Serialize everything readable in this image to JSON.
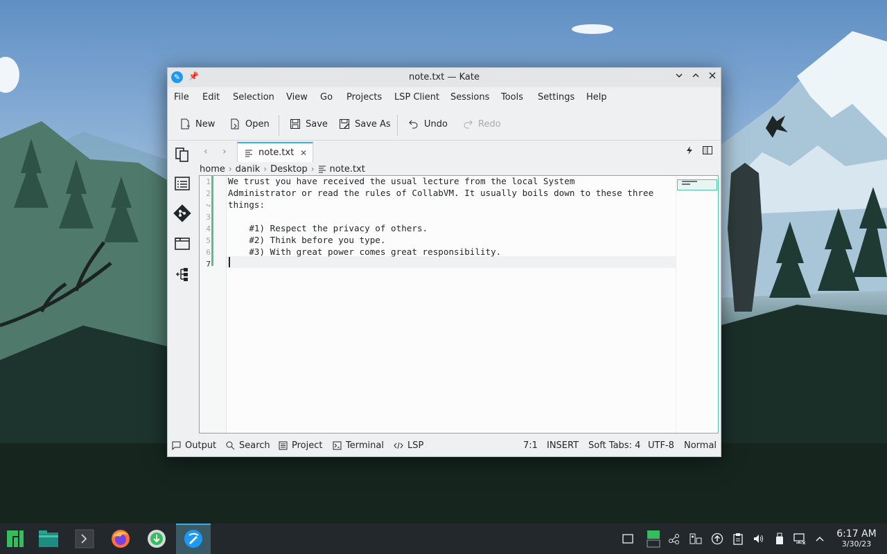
{
  "window": {
    "title": "note.txt — Kate"
  },
  "menu": [
    "File",
    "Edit",
    "Selection",
    "View",
    "Go",
    "Projects",
    "LSP Client",
    "Sessions",
    "Tools",
    "Settings",
    "Help"
  ],
  "toolbar": {
    "new": "New",
    "open": "Open",
    "save": "Save",
    "save_as": "Save As",
    "undo": "Undo",
    "redo": "Redo"
  },
  "tab": {
    "label": "note.txt"
  },
  "breadcrumb": [
    "home",
    "danik",
    "Desktop",
    "note.txt"
  ],
  "editor": {
    "line_numbers": [
      "1",
      "2",
      "",
      "3",
      "4",
      "5",
      "6",
      "7"
    ],
    "lines": [
      "We trust you have received the usual lecture from the local System",
      "Administrator or read the rules of CollabVM. It usually boils down to these three",
      "things:",
      "",
      "    #1) Respect the privacy of others.",
      "    #2) Think before you type.",
      "    #3) With great power comes great responsibility.",
      ""
    ]
  },
  "statusbar": {
    "output": "Output",
    "search": "Search",
    "project": "Project",
    "terminal": "Terminal",
    "lsp": "LSP",
    "cursor": "7:1",
    "mode": "INSERT",
    "indent": "Soft Tabs: 4",
    "encoding": "UTF-8",
    "highlight": "Normal"
  },
  "clock": {
    "time": "6:17 AM",
    "date": "3/30/23"
  },
  "colors": {
    "accent": "#3daee9",
    "taskbar": "#23282d",
    "modified": "#27ae60"
  },
  "icons": {
    "sidebar": [
      "documents-icon",
      "symbols-icon",
      "git-icon",
      "filesystem-icon",
      "projects-icon"
    ],
    "taskbar": [
      "manjaro-icon",
      "file-manager-icon",
      "terminal-icon",
      "firefox-icon",
      "software-center-icon",
      "kate-icon"
    ],
    "tray": [
      "show-desktop-icon",
      "vm-icon",
      "network-share-icon",
      "media-icon",
      "updates-icon",
      "clipboard-icon",
      "volume-icon",
      "usb-icon",
      "network-icon",
      "expand-tray-icon"
    ]
  }
}
